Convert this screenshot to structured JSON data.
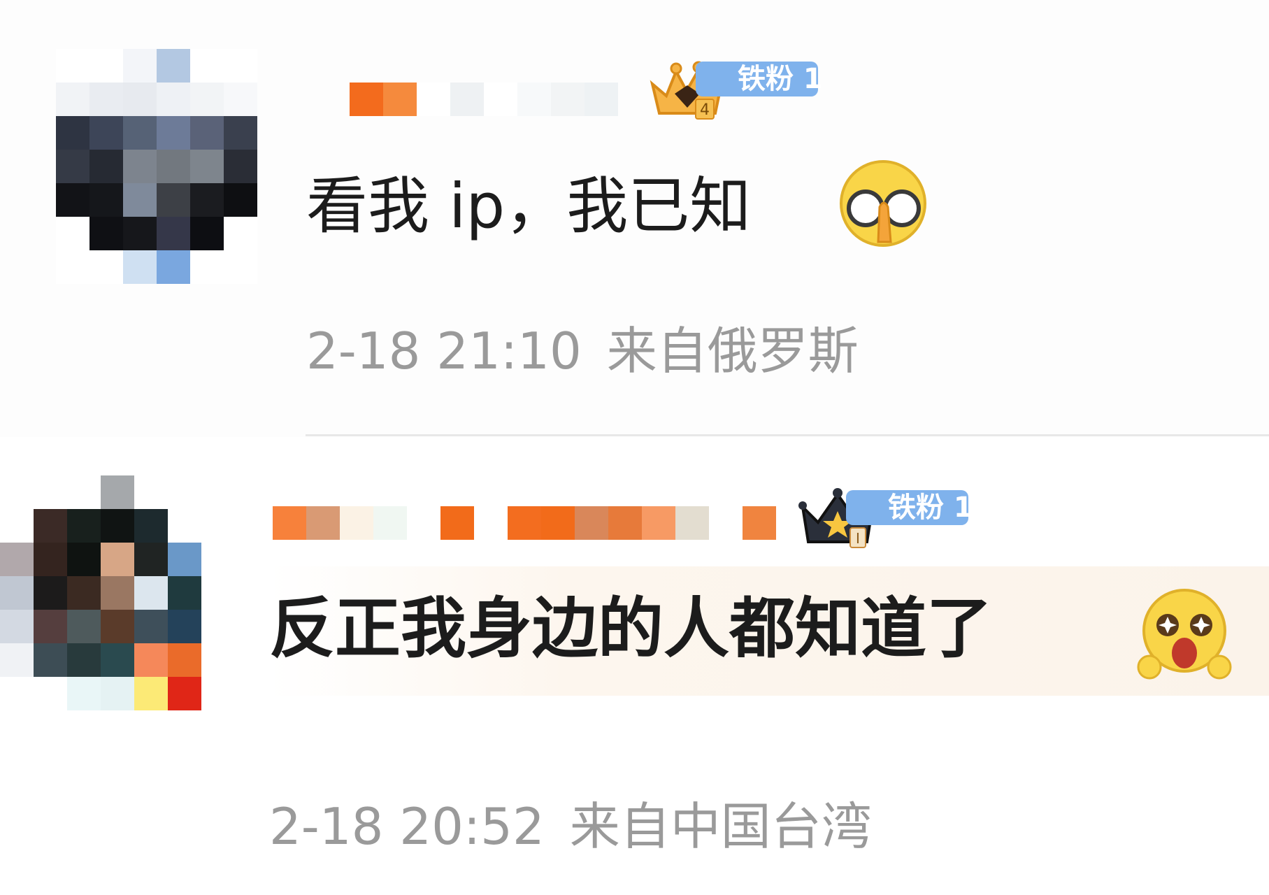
{
  "comments": [
    {
      "username": "",
      "fan_badge": {
        "label": "铁粉 1",
        "crown_level": "4"
      },
      "text": "看我 ip，我已知",
      "emoji": "glasses-facepalm-emoji",
      "timestamp": "2-18 21:10",
      "location": "来自俄罗斯"
    },
    {
      "username": "",
      "fan_badge": {
        "label": "铁粉 1",
        "crown_level": "I"
      },
      "text": "反正我身边的人都知道了",
      "emoji": "starry-eyed-emoji",
      "timestamp": "2-18 20:52",
      "location": "来自中国台湾"
    }
  ],
  "colors": {
    "badge_blue": "#7fb2ec",
    "meta_gray": "#9a9a9a",
    "username_orange": "#f36b1d"
  },
  "avatar_1_pixels": [
    "#ffffff",
    "#ffffff",
    "#f3f5f9",
    "#b3c8e2",
    "#ffffff",
    "#ffffff",
    "#f1f3f6",
    "#e9ecf1",
    "#e7eaef",
    "#eef1f5",
    "#f2f4f6",
    "#f7f8fa",
    "#2e3442",
    "#3d4558",
    "#566276",
    "#6d7b98",
    "#5a6278",
    "#3a404e",
    "#353a46",
    "#262a33",
    "#7d848e",
    "#72787f",
    "#7e858d",
    "#2a2d36",
    "#121317",
    "#15171b",
    "#7f8a9b",
    "#3d4046",
    "#1b1c20",
    "#0e0f12",
    "#ffffff",
    "#0f1014",
    "#16171b",
    "#353749",
    "#0d0e12",
    "#ffffff",
    "#ffffff",
    "#ffffff",
    "#cfe0f2",
    "#7aa7df",
    "#ffffff",
    "#ffffff"
  ],
  "avatar_2_pixels": [
    "#ffffff",
    "#ffffff",
    "#ffffff",
    "#a5a8ab",
    "#ffffff",
    "#ffffff",
    "#ffffff",
    "#3b2a26",
    "#18201d",
    "#101413",
    "#1d2a2e",
    "#ffffff",
    "#b1a8ab",
    "#34241f",
    "#0f1311",
    "#d7a686",
    "#202423",
    "#6a98c8",
    "#c0c7d2",
    "#1c1b1b",
    "#3b2a22",
    "#9a7762",
    "#dce6ee",
    "#1f3a3e",
    "#d3d9e2",
    "#553e3e",
    "#4e5a5c",
    "#5a3b2a",
    "#3e4f5a",
    "#24425a",
    "#f0f2f5",
    "#3d4d55",
    "#283a3c",
    "#2a4a4f",
    "#f5885a",
    "#ea6b2a",
    "#ffffff",
    "#ffffff",
    "#e9f6f7",
    "#e5f2f3",
    "#fcea76",
    "#e02617"
  ],
  "username_1_pixels": [
    "#f36b1d",
    "#f58a3d",
    "#ffffff",
    "#eef1f3",
    "#ffffff",
    "#f7f9fa",
    "#f2f4f5",
    "#eef2f4"
  ],
  "username_2_pixels": [
    "#f7813b",
    "#d99a74",
    "#fbf2e5",
    "#f0f7f2",
    "#ffffff",
    "#f26b1a",
    "#ffffff",
    "#f36d1f",
    "#f26b1a",
    "#d9875a",
    "#e77a3a",
    "#f79a64",
    "#e3ddd0",
    "#ffffff",
    "#f0843f"
  ]
}
